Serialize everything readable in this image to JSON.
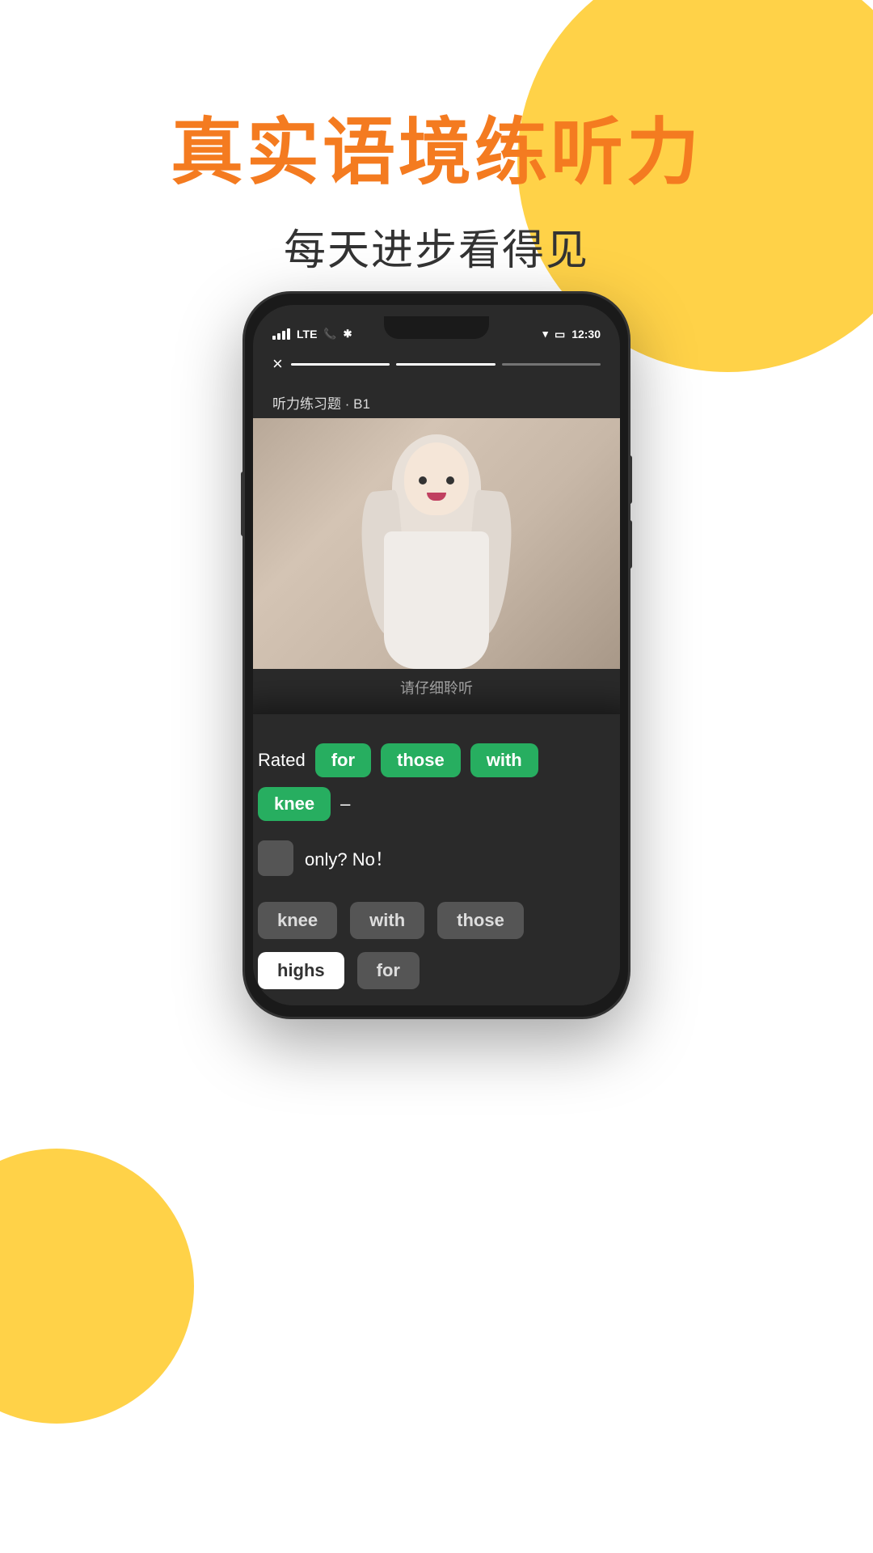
{
  "header": {
    "main_title": "真实语境练听力",
    "sub_title": "每天进步看得见"
  },
  "colors": {
    "orange": "#F47B20",
    "yellow": "#FFCA28",
    "green": "#27AE60",
    "dark_bg": "#2a2a2a"
  },
  "phone": {
    "status_bar": {
      "signal": "LTE",
      "time": "12:30"
    },
    "progress_segments": [
      {
        "active": true
      },
      {
        "active": true
      },
      {
        "active": false
      }
    ],
    "close_icon": "×",
    "exercise_label": "听力练习题 · B1",
    "listen_text": "请仔细聆听"
  },
  "answer_panel": {
    "rated_label": "Rated",
    "chips": [
      "for",
      "those",
      "with",
      "knee"
    ],
    "dash": "–",
    "blank": "",
    "rest_text": "only?  No！",
    "options": [
      {
        "text": "knee",
        "selected": false
      },
      {
        "text": "with",
        "selected": false
      },
      {
        "text": "those",
        "selected": false
      },
      {
        "text": "highs",
        "selected": true
      },
      {
        "text": "for",
        "selected": false
      }
    ]
  }
}
